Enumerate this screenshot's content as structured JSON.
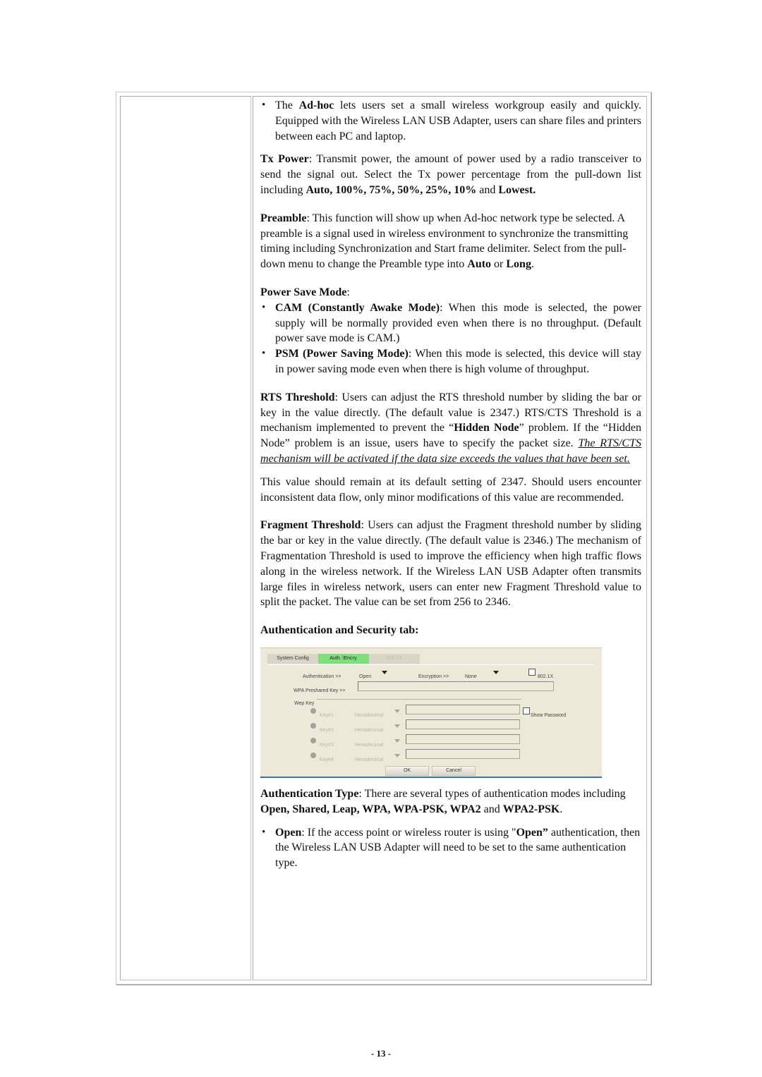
{
  "adhoc": {
    "pre": "The ",
    "bold": "Ad-hoc",
    "post": " lets users set a small wireless workgroup easily and quickly. Equipped with the Wireless LAN USB Adapter, users can share files and printers between each PC and laptop."
  },
  "tx_power": {
    "label": "Tx Power",
    "text": ": Transmit power, the amount of power used by a radio transceiver to send the signal out. Select the Tx power percentage from the pull-down list including ",
    "options": "Auto, 100%, 75%, 50%, 25%, 10%",
    "and": " and ",
    "last": "Lowest."
  },
  "preamble": {
    "label": "Preamble",
    "text": ": This function will show up when Ad-hoc network type be selected. A preamble is a signal used in wireless environment to synchronize the transmitting timing including Synchronization and Start frame delimiter. Select from the pull-down menu to change the Preamble type into ",
    "opt1": "Auto",
    "or": " or ",
    "opt2": "Long",
    "end": "."
  },
  "power_save": {
    "heading": "Power Save Mode",
    "colon": ":",
    "items": [
      {
        "bold": "CAM (Constantly Awake Mode)",
        "text": ": When this mode is selected, the power supply will be normally provided even when there is no throughput. (Default power save mode is CAM.)"
      },
      {
        "bold": "PSM (Power Saving Mode)",
        "text": ": When this mode is selected, this device will stay in power saving mode even when there is high volume of throughput."
      }
    ]
  },
  "rts": {
    "label": "RTS Threshold",
    "text1": ": Users can adjust the RTS threshold number by sliding the bar or key in the value directly. (The default value is 2347.) RTS/CTS Threshold is a mechanism implemented to prevent the “",
    "hidden_node": "Hidden Node",
    "text2": "” problem. If the “Hidden Node” problem is an issue, users have to specify the packet size. ",
    "underlined": "The RTS/CTS mechanism will be activated if the data size exceeds the values that have been set.",
    "note": "This value should remain at its default setting of 2347. Should users encounter inconsistent data flow, only minor modifications of this value are recommended."
  },
  "fragment": {
    "label": "Fragment Threshold",
    "text": ": Users can adjust the Fragment threshold number by sliding the bar or key in the value directly. (The default value is 2346.) The mechanism of Fragmentation Threshold is used to improve the efficiency when high traffic flows along in the wireless network. If the Wireless LAN USB Adapter often transmits large files in wireless network, users can enter new Fragment Threshold value to split the packet. The value can be set from 256 to 2346."
  },
  "auth_tab_heading": "Authentication and Security tab:",
  "screenshot": {
    "tabs": [
      {
        "label": "System Config",
        "state": "normal"
      },
      {
        "label": "Auth. \\Encry.",
        "state": "active"
      },
      {
        "label": "802.1X",
        "state": "disabled"
      }
    ],
    "authentication_label": "Authentication >>",
    "authentication_value": "Open",
    "encryption_label": "Encryption >>",
    "encryption_value": "None",
    "checkbox_8021x": "802.1X",
    "wpa_psk_label": "WPA Preshared Key >>",
    "wep_key_group": "Wep Key",
    "keys": [
      {
        "label": "Key#1",
        "format": "Hexadecimal"
      },
      {
        "label": "Key#2",
        "format": "Hexadecimal"
      },
      {
        "label": "Key#3",
        "format": "Hexadecimal"
      },
      {
        "label": "Key#4",
        "format": "Hexadecimal"
      }
    ],
    "show_password": "Show Password",
    "ok": "OK",
    "cancel": "Cancel",
    "colors": {
      "active_tab": "#7de07a",
      "panel": "#ece9d8",
      "bottom_bar": "#3a6fc4"
    }
  },
  "auth_type": {
    "label": "Authentication Type",
    "text": ": There are several types of authentication modes including ",
    "types": "Open, Shared, Leap, WPA, WPA-PSK, WPA2",
    "and": " and ",
    "last": "WPA2-PSK",
    "end": "."
  },
  "open_item": {
    "bold": "Open",
    "text1": ": If the access point or wireless router is using \"",
    "bold2": "Open”",
    "text2": " authentication, then the Wireless LAN USB Adapter will need to be set to the same authentication type."
  },
  "page_number": "- 13 -"
}
